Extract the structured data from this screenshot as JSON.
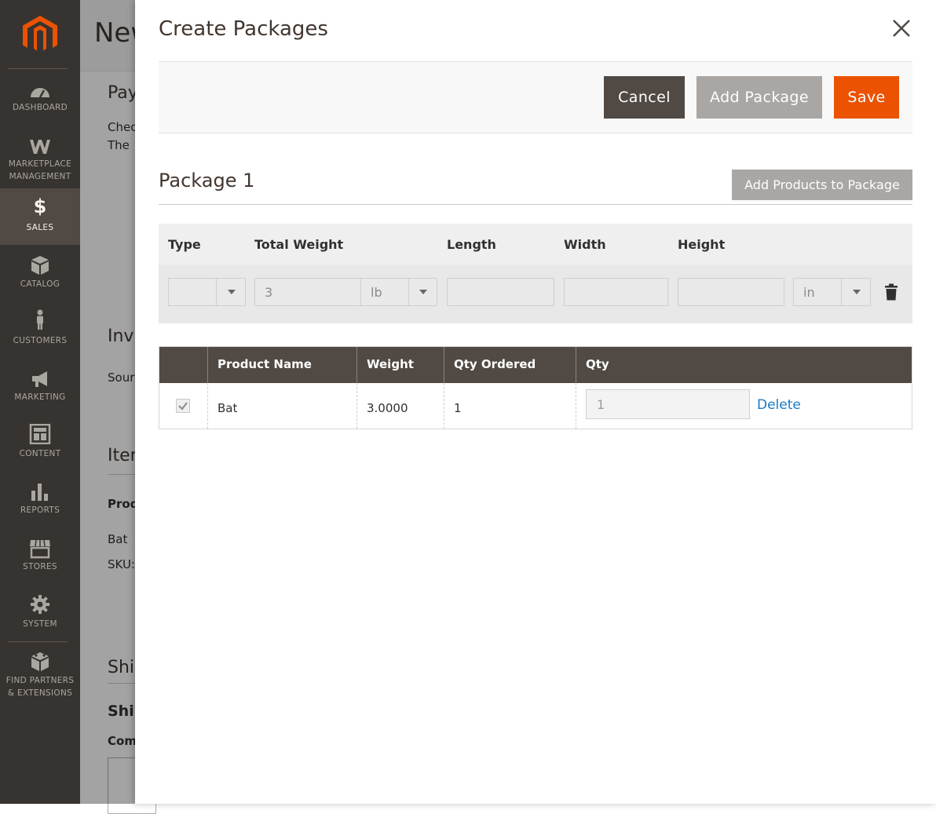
{
  "sidebar": {
    "items": [
      {
        "label": "DASHBOARD",
        "icon": "dashboard-icon"
      },
      {
        "label": "MARKETPLACE MANAGEMENT",
        "line1": "MARKETPLACE",
        "line2": "MANAGEMENT",
        "icon": "marketplace-icon"
      },
      {
        "label": "SALES",
        "icon": "dollar-icon",
        "active": true
      },
      {
        "label": "CATALOG",
        "icon": "box-icon"
      },
      {
        "label": "CUSTOMERS",
        "icon": "person-icon"
      },
      {
        "label": "MARKETING",
        "icon": "megaphone-icon"
      },
      {
        "label": "CONTENT",
        "icon": "layout-icon"
      },
      {
        "label": "REPORTS",
        "icon": "bar-chart-icon"
      },
      {
        "label": "STORES",
        "icon": "storefront-icon"
      },
      {
        "label": "SYSTEM",
        "icon": "gear-icon"
      },
      {
        "label": "FIND PARTNERS & EXTENSIONS",
        "line1": "FIND PARTNERS",
        "line2": "& EXTENSIONS",
        "icon": "blocks-icon"
      }
    ],
    "colors": {
      "bg": "#373330",
      "active": "#514943",
      "logo": "#eb5202"
    }
  },
  "background": {
    "page_title": "New",
    "texts": [
      "Pay",
      "Chec",
      "The",
      "Inv",
      "Sour",
      "Iter",
      "Prod",
      "Bat",
      "SKU:",
      "Shi",
      "Ship",
      "Com"
    ]
  },
  "modal": {
    "title": "Create Packages",
    "buttons": {
      "cancel": "Cancel",
      "add_package": "Add Package",
      "save": "Save"
    },
    "package": {
      "title": "Package 1",
      "add_products_label": "Add Products to Package",
      "headers": {
        "type": "Type",
        "total_weight": "Total Weight",
        "length": "Length",
        "width": "Width",
        "height": "Height"
      },
      "values": {
        "type": "",
        "total_weight": "3",
        "weight_unit": "lb",
        "length": "",
        "width": "",
        "height": "",
        "dimension_unit": "in"
      }
    },
    "products": {
      "headers": [
        "",
        "Product Name",
        "Weight",
        "Qty Ordered",
        "Qty"
      ],
      "rows": [
        {
          "checked": true,
          "name": "Bat",
          "weight": "3.0000",
          "qty_ordered": "1",
          "qty": "1",
          "delete_label": "Delete"
        }
      ]
    },
    "colors": {
      "primary": "#eb5202",
      "secondary": "#514943",
      "disabled": "#a9a6a4",
      "link": "#1979c3"
    }
  }
}
